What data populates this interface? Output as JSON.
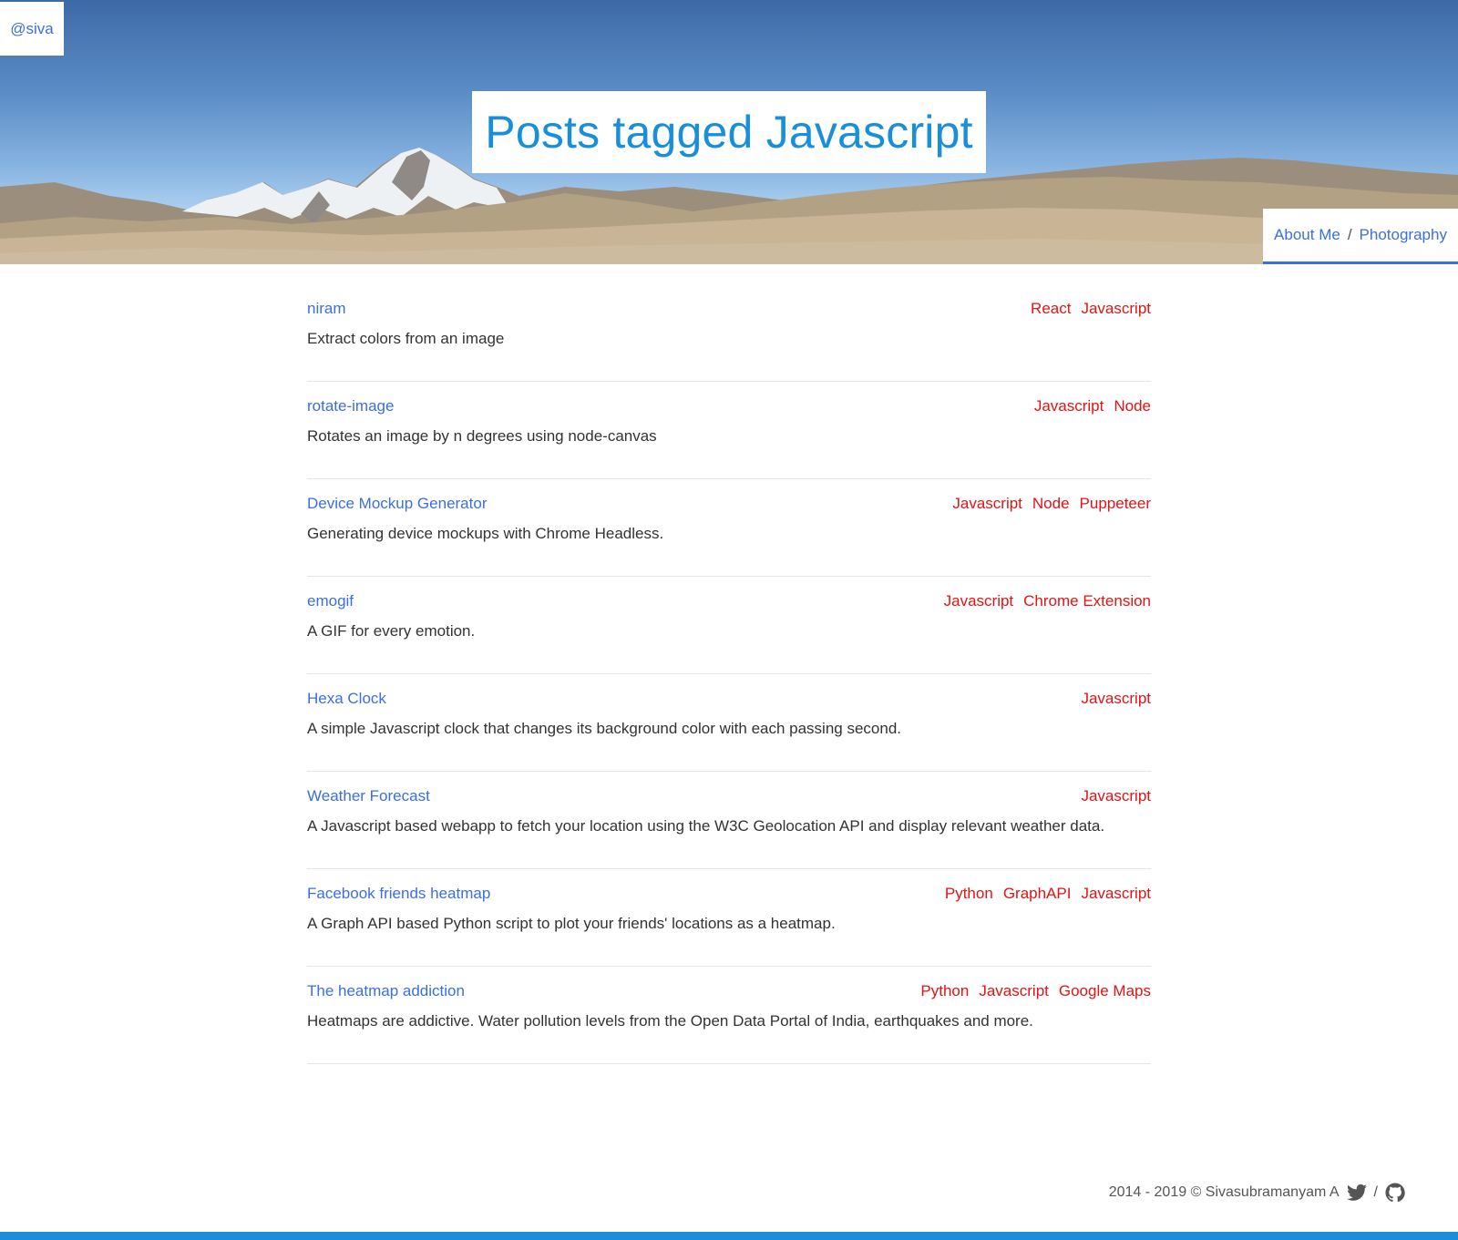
{
  "header": {
    "handle": "@siva",
    "title": "Posts tagged Javascript",
    "nav": {
      "about": "About Me",
      "separator": "/",
      "photography": "Photography"
    }
  },
  "posts": [
    {
      "title": "niram",
      "tags": [
        "React",
        "Javascript"
      ],
      "description": "Extract colors from an image"
    },
    {
      "title": "rotate-image",
      "tags": [
        "Javascript",
        "Node"
      ],
      "description": "Rotates an image by n degrees using node-canvas"
    },
    {
      "title": "Device Mockup Generator",
      "tags": [
        "Javascript",
        "Node",
        "Puppeteer"
      ],
      "description": "Generating device mockups with Chrome Headless."
    },
    {
      "title": "emogif",
      "tags": [
        "Javascript",
        "Chrome Extension"
      ],
      "description": "A GIF for every emotion."
    },
    {
      "title": "Hexa Clock",
      "tags": [
        "Javascript"
      ],
      "description": "A simple Javascript clock that changes its background color with each passing second."
    },
    {
      "title": "Weather Forecast",
      "tags": [
        "Javascript"
      ],
      "description": "A Javascript based webapp to fetch your location using the W3C Geolocation API and display relevant weather data."
    },
    {
      "title": "Facebook friends heatmap",
      "tags": [
        "Python",
        "GraphAPI",
        "Javascript"
      ],
      "description": "A Graph API based Python script to plot your friends' locations as a heatmap."
    },
    {
      "title": "The heatmap addiction",
      "tags": [
        "Python",
        "Javascript",
        "Google Maps"
      ],
      "description": "Heatmaps are addictive. Water pollution levels from the Open Data Portal of India, earthquakes and more."
    }
  ],
  "footer": {
    "copyright": "2014 - 2019 © Sivasubramanyam A",
    "separator": "/",
    "icons": [
      "twitter-icon",
      "github-icon"
    ]
  },
  "colors": {
    "link": "#3b6fe0",
    "tag": "#e01414",
    "title": "#1a8fd9",
    "accent_bar": "#1a8fd9"
  }
}
